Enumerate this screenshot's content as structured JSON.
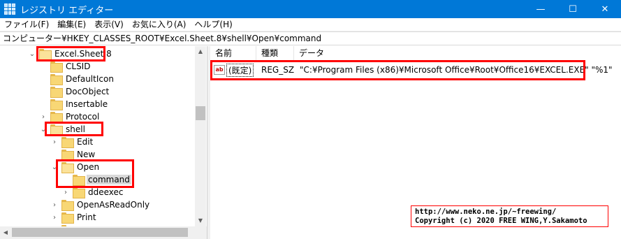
{
  "window": {
    "title": "レジストリ エディター",
    "minimize_glyph": "—",
    "maximize_glyph": "☐",
    "close_glyph": "✕"
  },
  "menu": [
    "ファイル(F)",
    "編集(E)",
    "表示(V)",
    "お気に入り(A)",
    "ヘルプ(H)"
  ],
  "address": "コンピューター¥HKEY_CLASSES_ROOT¥Excel.Sheet.8¥shell¥Open¥command",
  "tree": [
    {
      "label": "Excel.Sheet.8",
      "expander": "expanded",
      "open": true,
      "highlight": true
    },
    {
      "label": "CLSID",
      "expander": "none"
    },
    {
      "label": "DefaultIcon",
      "expander": "none"
    },
    {
      "label": "DocObject",
      "expander": "none"
    },
    {
      "label": "Insertable",
      "expander": "none"
    },
    {
      "label": "Protocol",
      "expander": "collapsed"
    },
    {
      "label": "shell",
      "expander": "expanded",
      "open": true,
      "highlight": true
    },
    {
      "label": "Edit",
      "expander": "collapsed"
    },
    {
      "label": "New",
      "expander": "none"
    },
    {
      "label": "Open",
      "expander": "expanded",
      "open": true,
      "highlight": true
    },
    {
      "label": "command",
      "expander": "none",
      "selected": true,
      "highlight": true
    },
    {
      "label": "ddeexec",
      "expander": "collapsed"
    },
    {
      "label": "OpenAsReadOnly",
      "expander": "collapsed"
    },
    {
      "label": "Print",
      "expander": "collapsed"
    },
    {
      "label": "",
      "expander": "none"
    }
  ],
  "values": {
    "columns": [
      "名前",
      "種類",
      "データ"
    ],
    "rows": [
      {
        "icon": "ab",
        "name": "(既定)",
        "type": "REG_SZ",
        "data": "\"C:¥Program Files (x86)¥Microsoft Office¥Root¥Office16¥EXCEL.EXE\" \"%1\""
      }
    ]
  },
  "credit": {
    "line1": "http://www.neko.ne.jp/~freewing/",
    "line2": "Copyright (c) 2020 FREE WING,Y.Sakamoto"
  },
  "colors": {
    "titlebar": "#0078d7",
    "annotation": "#ff0000",
    "folder": "#f8d775"
  }
}
